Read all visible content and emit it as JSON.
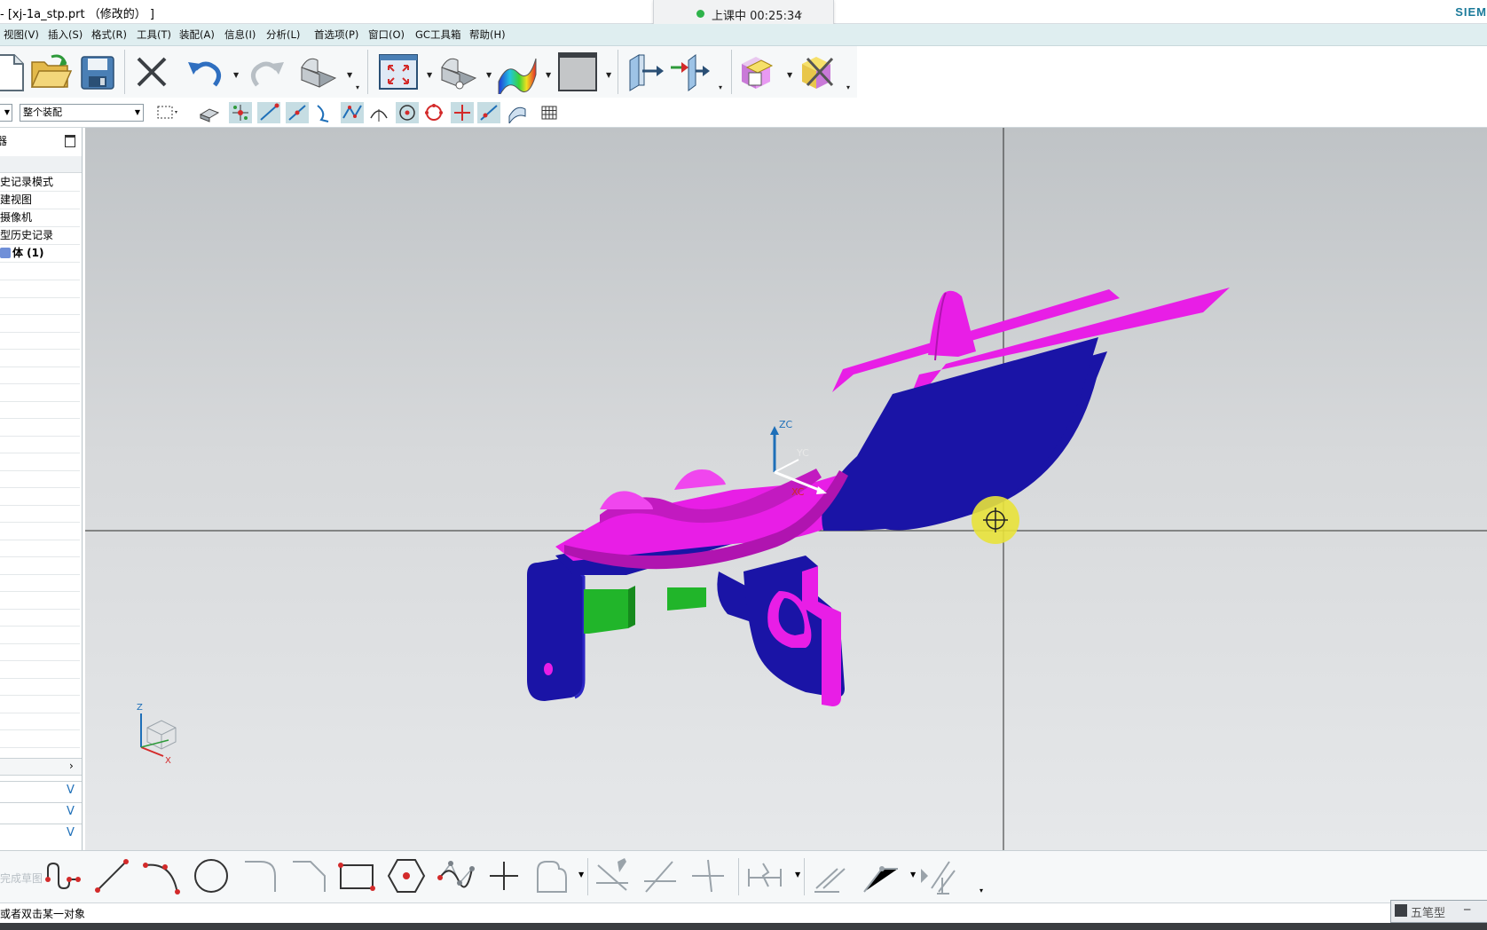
{
  "window": {
    "title": "- [xj-1a_stp.prt （修改的） ]",
    "brand": "SIEM"
  },
  "recording": {
    "status": "上课中 00:25:34"
  },
  "menu": [
    {
      "label": "视图(V)"
    },
    {
      "label": "插入(S)"
    },
    {
      "label": "格式(R)"
    },
    {
      "label": "工具(T)"
    },
    {
      "label": "装配(A)"
    },
    {
      "label": "信息(I)"
    },
    {
      "label": "分析(L)"
    },
    {
      "label": "首选项(P)"
    },
    {
      "label": "窗口(O)"
    },
    {
      "label": "GC工具箱"
    },
    {
      "label": "帮助(H)"
    }
  ],
  "toolbar": {
    "icons": [
      "new-file-icon",
      "open-folder-icon",
      "save-icon",
      "delete-icon",
      "undo-icon",
      "redo-icon",
      "part-shade-icon",
      "fit-view-icon",
      "part-view-icon",
      "surface-color-icon",
      "background-icon",
      "extrude-arrow-icon",
      "assembly-arrow-icon",
      "component-icon",
      "remove-component-icon"
    ]
  },
  "selection_bar": {
    "filter_value": "整个装配",
    "colors": {
      "active_bg": "#c6dde3"
    }
  },
  "navigator": {
    "rows": [
      {
        "label": "史记录模式"
      },
      {
        "label": "建视图"
      },
      {
        "label": "摄像机"
      },
      {
        "label": "型历史记录"
      },
      {
        "label": "体 (1)"
      }
    ],
    "scroll_right": "›",
    "accordion": [
      "V",
      "V",
      "V"
    ]
  },
  "viewport": {
    "csys_labels": {
      "zc": "ZC",
      "yc": "YC",
      "xc": "XC"
    },
    "triad_labels": {
      "z": "Z",
      "x": "X"
    },
    "colors": {
      "magenta": "#e81ee6",
      "blue": "#1a14a6",
      "green": "#21b52a",
      "cursor": "#e8e23a"
    }
  },
  "sketch_toolbar": {
    "finish_label": "完成草图"
  },
  "status": {
    "message": "或者双击某一对象"
  },
  "ime": {
    "label": "五笔型"
  }
}
